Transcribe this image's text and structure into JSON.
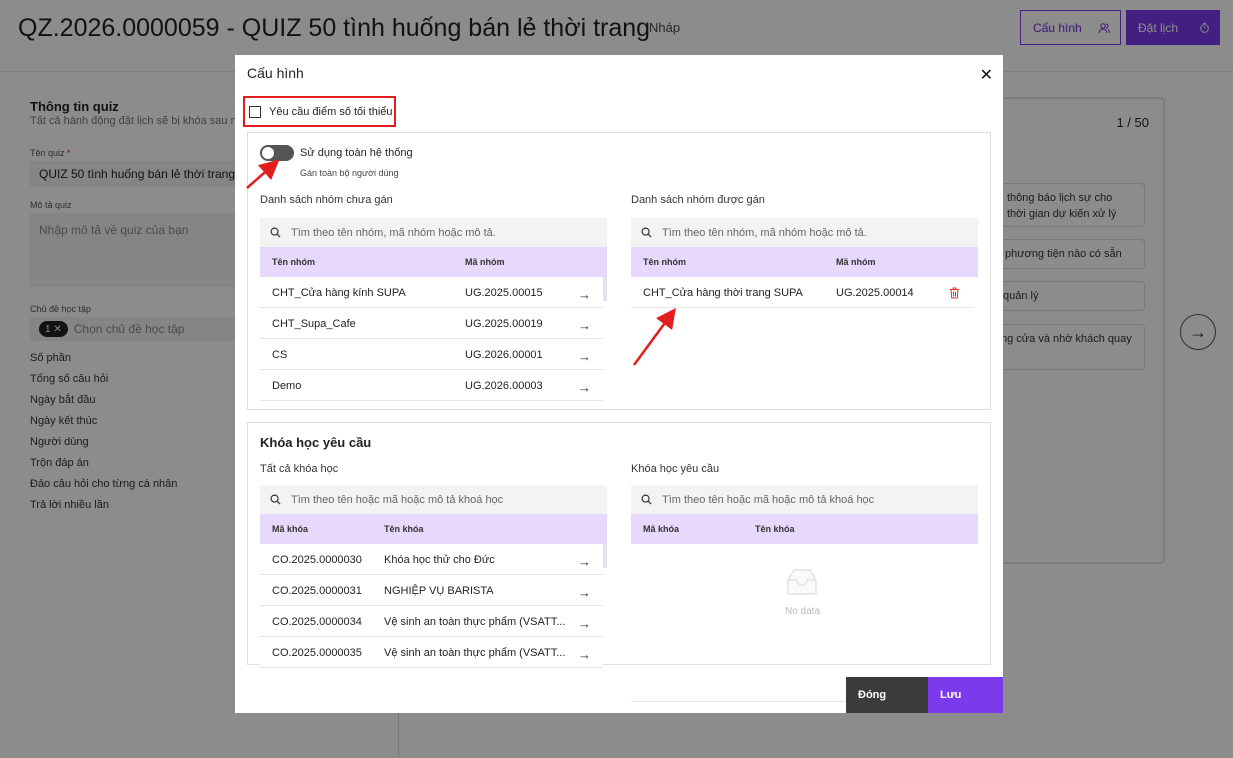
{
  "page": {
    "title": "QZ.2026.0000059 - QUIZ 50 tình huống bán lẻ thời trang",
    "status": "Nháp",
    "config_button": "Cấu hình",
    "schedule_button": "Đặt lịch",
    "info_title": "Thông tin quiz",
    "info_subtitle": "Tất cả hành động đặt lịch sẽ bị khóa sau ng",
    "quiz_name_label": "Tên quiz",
    "quiz_name_required": "*",
    "quiz_name_value": "QUIZ 50 tình huống bán lẻ thời trang",
    "description_label": "Mô tả quiz",
    "description_placeholder": "Nhập mô tả về quiz của bạn",
    "topic_label": "Chủ đề học tập",
    "topic_chip": "1",
    "topic_placeholder": "Chọn chủ đề học tập",
    "rows": [
      "Số phần",
      "Tổng số câu hỏi",
      "Ngày bắt đầu",
      "Ngày kết thúc",
      "Người dùng",
      "Trộn đáp án",
      "Đảo câu hỏi cho từng cá nhân",
      "Trả lời nhiều lần"
    ],
    "counter": "1 / 50",
    "options": [
      "thông báo lịch sự cho\nthời gian dự kiến xử lý",
      "phương tiện nào có sẵn",
      "quản lý",
      "ng cửa và nhờ khách quay"
    ]
  },
  "modal": {
    "title": "Cấu hình",
    "require_min_score": "Yêu cầu điểm số tối thiểu",
    "toggle_label": "Sử dụng toàn hệ thống",
    "toggle_hint": "Gán toàn bộ người dùng",
    "unassigned_label": "Danh sách nhóm chưa gán",
    "assigned_label": "Danh sách nhóm được gán",
    "group_search_placeholder": "Tìm theo tên nhóm, mã nhóm hoặc mô tả.",
    "group_col_name": "Tên nhóm",
    "group_col_code": "Mã nhóm",
    "unassigned_groups": [
      {
        "name": "CHT_Cửa hàng kính SUPA",
        "code": "UG.2025.00015"
      },
      {
        "name": "CHT_Supa_Cafe",
        "code": "UG.2025.00019"
      },
      {
        "name": "CS",
        "code": "UG.2026.00001"
      },
      {
        "name": "Demo",
        "code": "UG.2026.00003"
      }
    ],
    "assigned_groups": [
      {
        "name": "CHT_Cửa hàng thời trang SUPA",
        "code": "UG.2025.00014"
      }
    ],
    "course_section_title": "Khóa học yêu cầu",
    "all_courses_label": "Tất cả khóa học",
    "required_courses_label": "Khóa học yêu cầu",
    "course_search_all": "Tìm theo tên hoặc mã hoặc mô tả khoá học",
    "course_search_required": "Tìm theo tên hoặc mã hoặc mô tả khoá học",
    "course_col_code": "Mã khóa",
    "course_col_name": "Tên khóa",
    "courses": [
      {
        "code": "CO.2025.0000030",
        "name": "Khóa học thử cho Đức"
      },
      {
        "code": "CO.2025.0000031",
        "name": "NGHIỆP VỤ BARISTA"
      },
      {
        "code": "CO.2025.0000034",
        "name": "Vệ sinh an toàn thực phẩm (VSATT..."
      },
      {
        "code": "CO.2025.0000035",
        "name": "Vệ sinh an toàn thực phẩm (VSATT..."
      }
    ],
    "no_data": "No data",
    "close_button": "Đóng",
    "save_button": "Lưu"
  },
  "colors": {
    "accent": "#7c3aed",
    "header_row": "#e6d9fb",
    "annotation": "#e21d1d"
  }
}
